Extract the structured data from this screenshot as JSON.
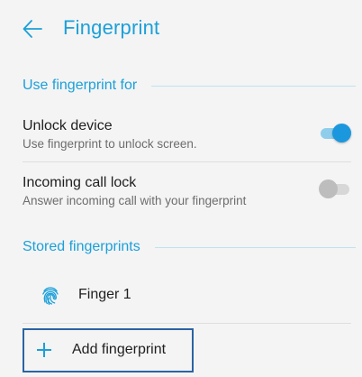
{
  "header": {
    "title": "Fingerprint",
    "back_icon": "arrow-left-icon"
  },
  "sections": {
    "use_for": {
      "title": "Use fingerprint for",
      "items": [
        {
          "title": "Unlock device",
          "subtitle": "Use fingerprint to unlock screen.",
          "enabled": true
        },
        {
          "title": "Incoming call lock",
          "subtitle": "Answer incoming call with your fingerprint",
          "enabled": false
        }
      ]
    },
    "stored": {
      "title": "Stored fingerprints",
      "fingerprints": [
        {
          "name": "Finger 1",
          "icon": "fingerprint-icon"
        }
      ],
      "add_label": "Add fingerprint",
      "add_icon": "plus-icon"
    }
  },
  "colors": {
    "accent": "#1ba0d9",
    "switch_on": "#1b98dd",
    "switch_off": "#bdbdbd",
    "focus_border": "#2a63a4"
  }
}
